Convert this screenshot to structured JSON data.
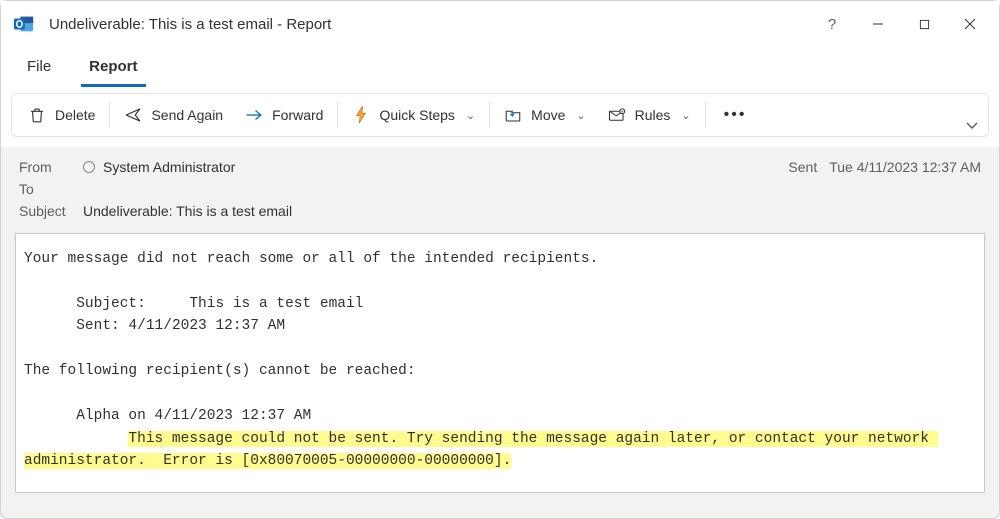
{
  "window": {
    "title": "Undeliverable: This is a test email  -  Report"
  },
  "tabs": {
    "file": "File",
    "report": "Report"
  },
  "ribbon": {
    "delete": "Delete",
    "send_again": "Send Again",
    "forward": "Forward",
    "quick_steps": "Quick Steps",
    "move": "Move",
    "rules": "Rules"
  },
  "header": {
    "from_label": "From",
    "from_value": "System Administrator",
    "to_label": "To",
    "to_value": "",
    "subject_label": "Subject",
    "subject_value": "Undeliverable: This is a test email",
    "sent_label": "Sent",
    "sent_value": "Tue 4/11/2023 12:37 AM"
  },
  "body": {
    "line1": "Your message did not reach some or all of the intended recipients.",
    "subj_lbl": "      Subject:",
    "subj_val": "     This is a test email",
    "sent_lbl": "      Sent:",
    "sent_val": " 4/11/2023 12:37 AM",
    "line2": "The following recipient(s) cannot be reached:",
    "recip": "      Alpha on 4/11/2023 12:37 AM",
    "indent": "            ",
    "err": "This message could not be sent. Try sending the message again later, or contact your network administrator.  Error is [0x80070005-00000000-00000000]."
  }
}
